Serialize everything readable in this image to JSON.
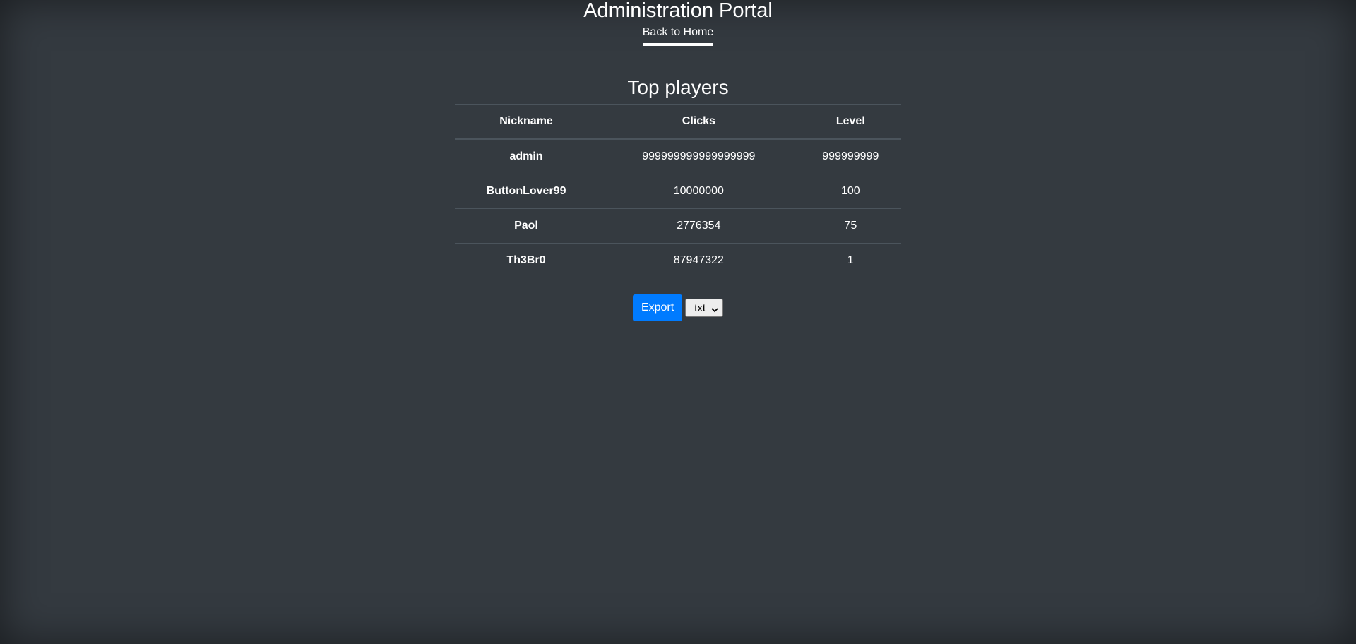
{
  "header": {
    "title": "Administration Portal",
    "nav_link": "Back to Home"
  },
  "leaderboard": {
    "title": "Top players",
    "columns": [
      "Nickname",
      "Clicks",
      "Level"
    ],
    "rows": [
      {
        "nickname": "admin",
        "clicks": "999999999999999999",
        "level": "999999999"
      },
      {
        "nickname": "ButtonLover99",
        "clicks": "10000000",
        "level": "100"
      },
      {
        "nickname": "Paol",
        "clicks": "2776354",
        "level": "75"
      },
      {
        "nickname": "Th3Br0",
        "clicks": "87947322",
        "level": "1"
      }
    ]
  },
  "export": {
    "button_label": "Export",
    "format_selected": "txt",
    "caret_icon": "chevron-down-icon"
  },
  "colors": {
    "background": "#343a40",
    "primary": "#007bff"
  }
}
